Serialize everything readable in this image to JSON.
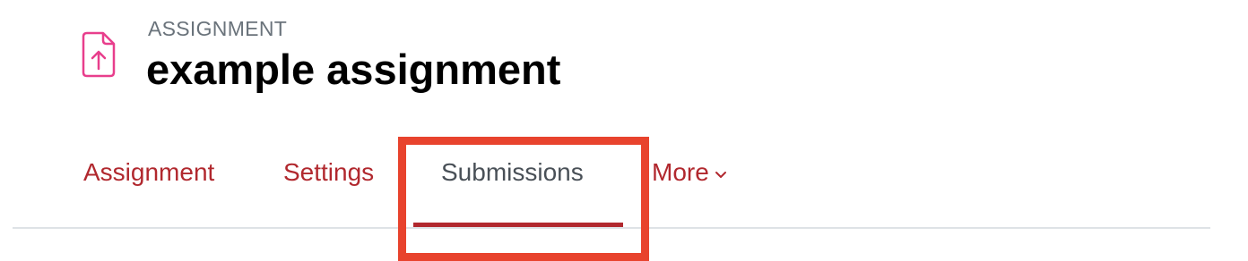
{
  "header": {
    "icon": "file-upload-icon",
    "activity_type": "ASSIGNMENT",
    "title": "example assignment"
  },
  "nav": {
    "tabs": [
      {
        "label": "Assignment",
        "active": false
      },
      {
        "label": "Settings",
        "active": false
      },
      {
        "label": "Submissions",
        "active": true
      },
      {
        "label": "More",
        "active": false,
        "icon": "chevron-down-icon"
      }
    ]
  },
  "colors": {
    "link": "#b1282e",
    "active_tab_text": "#495057",
    "icon_pink": "#e83e8c",
    "highlight": "#e8432d",
    "divider": "#dee2e6"
  }
}
